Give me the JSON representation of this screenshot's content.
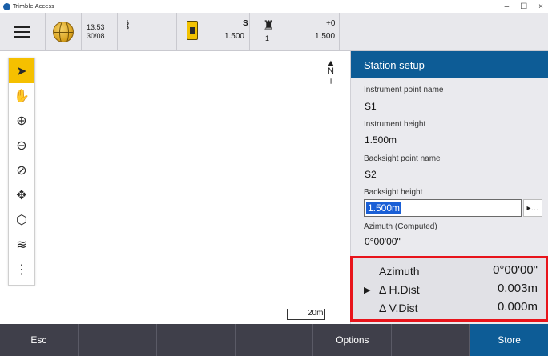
{
  "window": {
    "title": "Trimble Access",
    "min_label": "–",
    "max_label": "☐",
    "close_label": "×"
  },
  "status": {
    "time": "13:53",
    "date": "30/08",
    "instrument_s": "S",
    "instrument_height": "1.500",
    "prism_constant": "+0",
    "prism_id": "1",
    "prism_height": "1.500"
  },
  "toolbar": {
    "tools": [
      "select-arrow",
      "pan-hand",
      "zoom-in",
      "zoom-out",
      "zoom-extents",
      "orbit",
      "3d-view",
      "layers",
      "more"
    ]
  },
  "map": {
    "north_label": "N",
    "scale_label": "20m"
  },
  "panel": {
    "title": "Station setup",
    "instrument_point_label": "Instrument point name",
    "instrument_point_value": "S1",
    "instrument_height_label": "Instrument height",
    "instrument_height_value": "1.500m",
    "backsight_point_label": "Backsight point name",
    "backsight_point_value": "S2",
    "backsight_height_label": "Backsight height",
    "backsight_height_value": "1.500m",
    "azimuth_label": "Azimuth (Computed)",
    "azimuth_value": "0°00'00\""
  },
  "readout": {
    "azimuth_label": "Azimuth",
    "azimuth_value": "0°00'00\"",
    "hdist_label": "Δ H.Dist",
    "hdist_value": "0.003m",
    "vdist_label": "Δ V.Dist",
    "vdist_value": "0.000m"
  },
  "bottom": {
    "esc_label": "Esc",
    "options_label": "Options",
    "store_label": "Store"
  },
  "colors": {
    "accent": "#0d5c96",
    "highlight": "#f5c000",
    "alert_border": "#e8141b"
  }
}
